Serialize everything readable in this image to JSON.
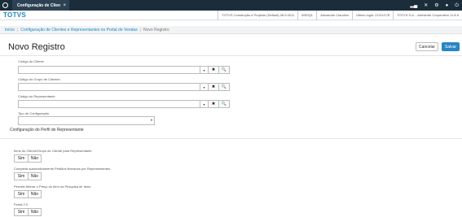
{
  "topbar": {
    "tab_title": "Configuração de Clien",
    "tab_close": "×",
    "icons": [
      "signal-icon",
      "shuffle-icon",
      "gear-icon",
      "help-icon",
      "power-icon"
    ]
  },
  "brand": "TOTVS",
  "context": {
    "items": [
      "TOTVS Construção e Projetos (Default) 08.9.0011",
      "MSSQL",
      "Alexandre Claudino",
      "Último login: 21/01/178",
      "TOTVS S.A. - Ambiente Corporativo 11.8.5"
    ]
  },
  "breadcrumb": {
    "home": "Início",
    "parent": "Configuração de Clientes e Representantes no Portal de Vendas",
    "current": "Novo Registro"
  },
  "page": {
    "title": "Novo Registro",
    "cancel_label": "Cancelar",
    "save_label": "Salvar"
  },
  "fields": {
    "client_code_label": "Código do Cliente",
    "client_group_label": "Código do Grupo de Clientes",
    "rep_code_label": "Código do Representante",
    "config_type_label": "Tipo de Configuração",
    "caret": "▾",
    "clear": "✖",
    "search": "🔍"
  },
  "rep_profile": {
    "section_title": "Configuração do Perfil de Representante",
    "toggles": [
      {
        "label": "Itens do Cliente/Grupo de Cliente para Representante",
        "yes": "Sim",
        "no": "Não"
      },
      {
        "label": "Completa automaticamente Pedidos liberados por Representantes",
        "yes": "Sim",
        "no": "Não"
      },
      {
        "label": "Permite Alterar o Preço do Item na Pesquisa de Itens",
        "yes": "Sim",
        "no": "Não"
      },
      {
        "label": "Portal 2.0",
        "yes": "Sim",
        "no": "Não"
      }
    ]
  }
}
